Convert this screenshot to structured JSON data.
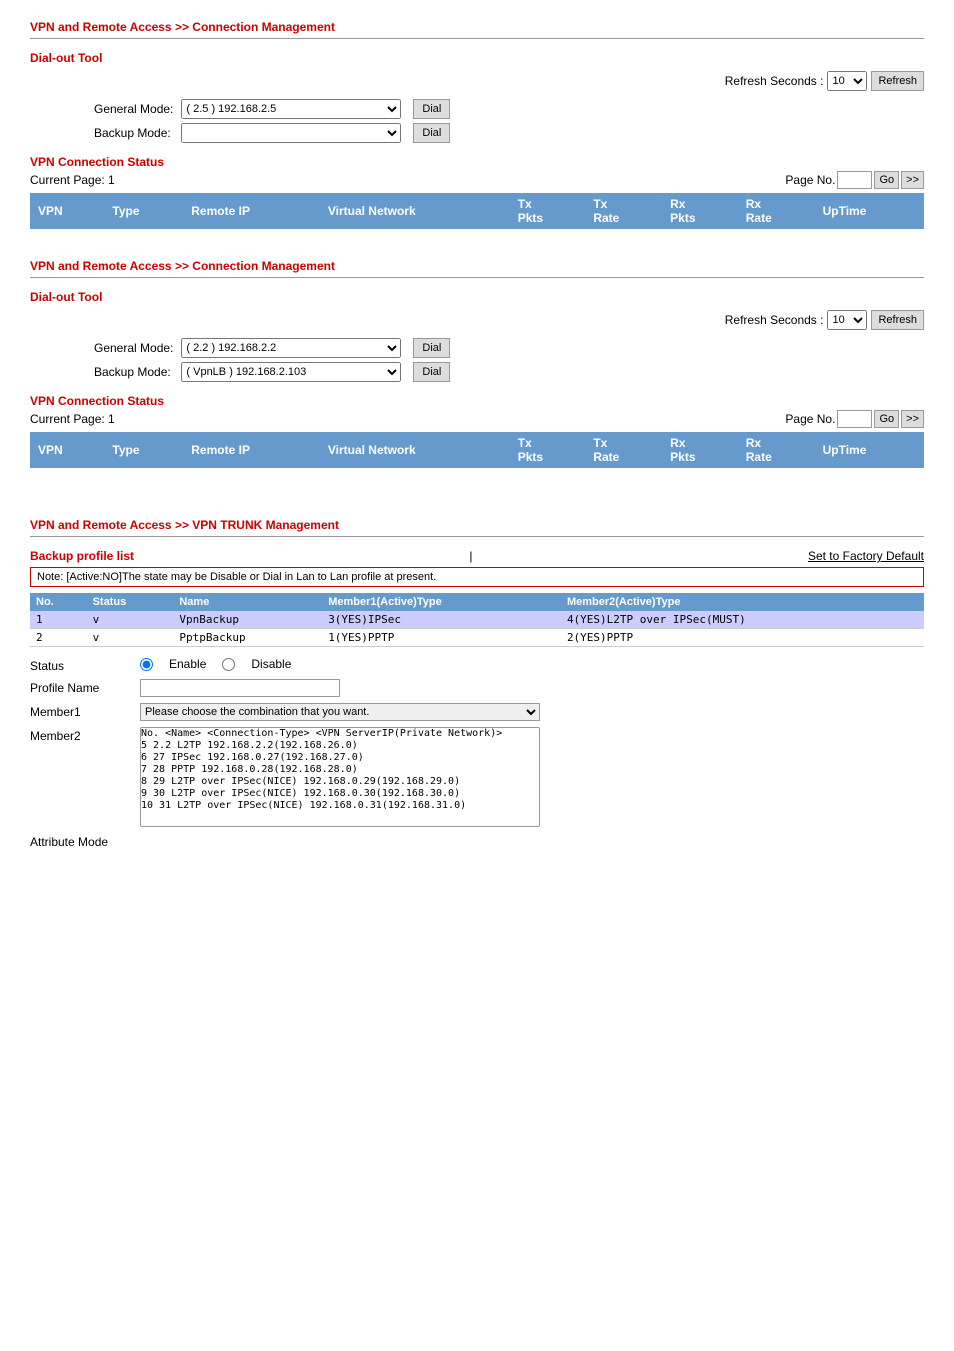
{
  "sections": [
    {
      "id": "section1",
      "title": "VPN and Remote Access >> Connection Management",
      "dialOutTool": {
        "label": "Dial-out Tool",
        "refreshLabel": "Refresh Seconds :",
        "refreshValue": "10",
        "refreshBtnLabel": "Refresh",
        "generalModeLabel": "General Mode:",
        "generalModeValue": "( 2.5 ) 192.168.2.5",
        "backupModeLabel": "Backup Mode:",
        "backupModeValue": "",
        "dialLabel": "Dial"
      },
      "vpnStatus": {
        "label": "VPN Connection Status",
        "currentPage": "Current Page:  1",
        "pageNoLabel": "Page No.",
        "goBtnLabel": "Go",
        "nextBtnLabel": ">>",
        "tableHeaders": [
          "VPN",
          "Type",
          "Remote IP",
          "Virtual Network",
          "Tx\nPkts",
          "Tx\nRate",
          "Rx\nPkts",
          "Rx\nRate",
          "UpTime"
        ],
        "rows": []
      }
    },
    {
      "id": "section2",
      "title": "VPN and Remote Access >> Connection Management",
      "dialOutTool": {
        "label": "Dial-out Tool",
        "refreshLabel": "Refresh Seconds :",
        "refreshValue": "10",
        "refreshBtnLabel": "Refresh",
        "generalModeLabel": "General Mode:",
        "generalModeValue": "( 2.2 ) 192.168.2.2",
        "backupModeLabel": "Backup Mode:",
        "backupModeValue": "( VpnLB ) 192.168.2.103",
        "dialLabel": "Dial"
      },
      "vpnStatus": {
        "label": "VPN Connection Status",
        "currentPage": "Current Page:  1",
        "pageNoLabel": "Page No.",
        "goBtnLabel": "Go",
        "nextBtnLabel": ">>",
        "tableHeaders": [
          "VPN",
          "Type",
          "Remote IP",
          "Virtual Network",
          "Tx\nPkts",
          "Tx\nRate",
          "Rx\nPkts",
          "Rx\nRate",
          "UpTime"
        ],
        "rows": []
      }
    }
  ],
  "trunkSection": {
    "title": "VPN and Remote Access >> VPN TRUNK Management",
    "backupProfileLabel": "Backup profile list",
    "setFactoryLabel": "Set to Factory Default",
    "noteText": "Note:  [Active:NO]The state may be Disable or Dial in Lan to Lan profile at present.",
    "profileTableHeaders": [
      "No.",
      "Status",
      "Name",
      "Member1(Active)Type",
      "Member2(Active)Type"
    ],
    "profileRows": [
      {
        "no": "1",
        "status": "v",
        "name": "VpnBackup",
        "member1": "3(YES)IPSec",
        "member2": "4(YES)L2TP over IPSec(MUST)",
        "highlighted": true
      },
      {
        "no": "2",
        "status": "v",
        "name": "PptpBackup",
        "member1": "1(YES)PPTP",
        "member2": "2(YES)PPTP",
        "highlighted": false
      }
    ],
    "statusLabel": "Status",
    "enableLabel": "Enable",
    "disableLabel": "Disable",
    "profileNameLabel": "Profile Name",
    "profileNameValue": "",
    "member1Label": "Member1",
    "member1Placeholder": "Please choose the combination that you want.",
    "member2Label": "Member2",
    "member2DropdownText": "Please choose the combination that you want.",
    "attributeModeLabel": "Attribute Mode",
    "dropdownOptions": [
      "No.  <Name>        <Connection-Type>     <VPN ServerIP(Private Network)>",
      "5    2.2           L2TP                  192.168.2.2(192.168.26.0)",
      "6    27            IPSec                 192.168.0.27(192.168.27.0)",
      "7    28            PPTP                  192.168.0.28(192.168.28.0)",
      "8    29            L2TP over IPSec(NICE) 192.168.0.29(192.168.29.0)",
      "9    30            L2TP over IPSec(NICE) 192.168.0.30(192.168.30.0)",
      "10   31            L2TP over IPSec(NICE) 192.168.0.31(192.168.31.0)"
    ]
  }
}
